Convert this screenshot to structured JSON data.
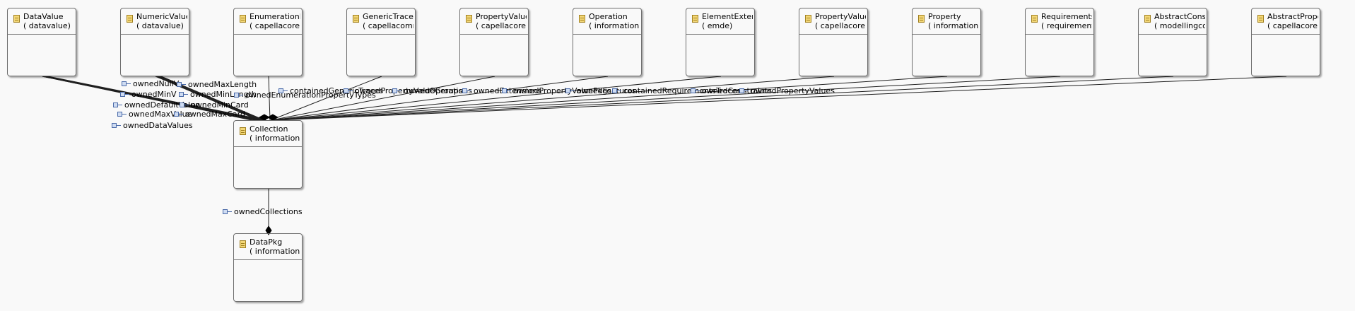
{
  "diagram": {
    "nodes": [
      {
        "id": "datavalue",
        "name": "DataValue",
        "pkg": "( datavalue)",
        "tone": "green"
      },
      {
        "id": "numericvalue",
        "name": "NumericValue",
        "pkg": "( datavalue)",
        "tone": "green"
      },
      {
        "id": "enumerationpropertytype",
        "name": "EnumerationPropertyType",
        "pkg": "( capellacore)",
        "tone": "grey"
      },
      {
        "id": "generictrace",
        "name": "GenericTrace",
        "pkg": "( capellacommon)",
        "tone": "grey"
      },
      {
        "id": "propertyvaluegroup",
        "name": "PropertyValueGroup",
        "pkg": "( capellacore)",
        "tone": "grey"
      },
      {
        "id": "operation",
        "name": "Operation",
        "pkg": "( information)",
        "tone": "green"
      },
      {
        "id": "elementextension",
        "name": "ElementExtension",
        "pkg": "( emde)",
        "tone": "green"
      },
      {
        "id": "propertyvaluepkg",
        "name": "PropertyValuePkg",
        "pkg": "( capellacore)",
        "tone": "grey"
      },
      {
        "id": "property",
        "name": "Property",
        "pkg": "( information)",
        "tone": "grey"
      },
      {
        "id": "requirementstrace",
        "name": "RequirementsTrace",
        "pkg": "( requirement)",
        "tone": "grey"
      },
      {
        "id": "abstractconstraint",
        "name": "AbstractConstraint",
        "pkg": "( modellingcore)",
        "tone": "green"
      },
      {
        "id": "abstractpropertyvalue",
        "name": "AbstractPropertyValue",
        "pkg": "( capellacore)",
        "tone": "green"
      },
      {
        "id": "collection",
        "name": "Collection",
        "pkg": "( information)",
        "tone": "grey"
      },
      {
        "id": "datapkg",
        "name": "DataPkg",
        "pkg": "( information)",
        "tone": "grey"
      }
    ],
    "edge_labels": [
      {
        "id": "ownedNullValue",
        "text": "ownedNullV"
      },
      {
        "id": "ownedMaxLength",
        "text": "ownedMaxLength"
      },
      {
        "id": "ownedMinValue",
        "text": "ownedMinV"
      },
      {
        "id": "ownedMinLength",
        "text": "ownedMinLength"
      },
      {
        "id": "ownedEnumerationPropertyTypes",
        "text": "ownedEnumerationPropertyTypes"
      },
      {
        "id": "ownedDefaultValue",
        "text": "ownedDefaultValue"
      },
      {
        "id": "ownedMinCard",
        "text": "ownedMinCard"
      },
      {
        "id": "ownedMaxValue",
        "text": "ownedMaxValue"
      },
      {
        "id": "ownedMaxCard",
        "text": "ownedMaxCard"
      },
      {
        "id": "ownedDataValues",
        "text": "ownedDataValues"
      },
      {
        "id": "containedGenericTraces",
        "text": "containedGenericTraces"
      },
      {
        "id": "ownedPropertyValueGroups",
        "text": "ownedPropertyValueGroups"
      },
      {
        "id": "ownedOperations",
        "text": "ownedOperations"
      },
      {
        "id": "ownedExtensions",
        "text": "ownedExtensions"
      },
      {
        "id": "ownedPropertyValuePkgs",
        "text": "ownedPropertyValuePkgs"
      },
      {
        "id": "ownedFeatures",
        "text": "ownedFeatures"
      },
      {
        "id": "containedRequirementsTraces",
        "text": "containedRequirementsTraces"
      },
      {
        "id": "ownedConstraints",
        "text": "ownedConstraints"
      },
      {
        "id": "ownedPropertyValues",
        "text": "ownedPropertyValues"
      },
      {
        "id": "ownedCollections",
        "text": "ownedCollections"
      }
    ]
  }
}
